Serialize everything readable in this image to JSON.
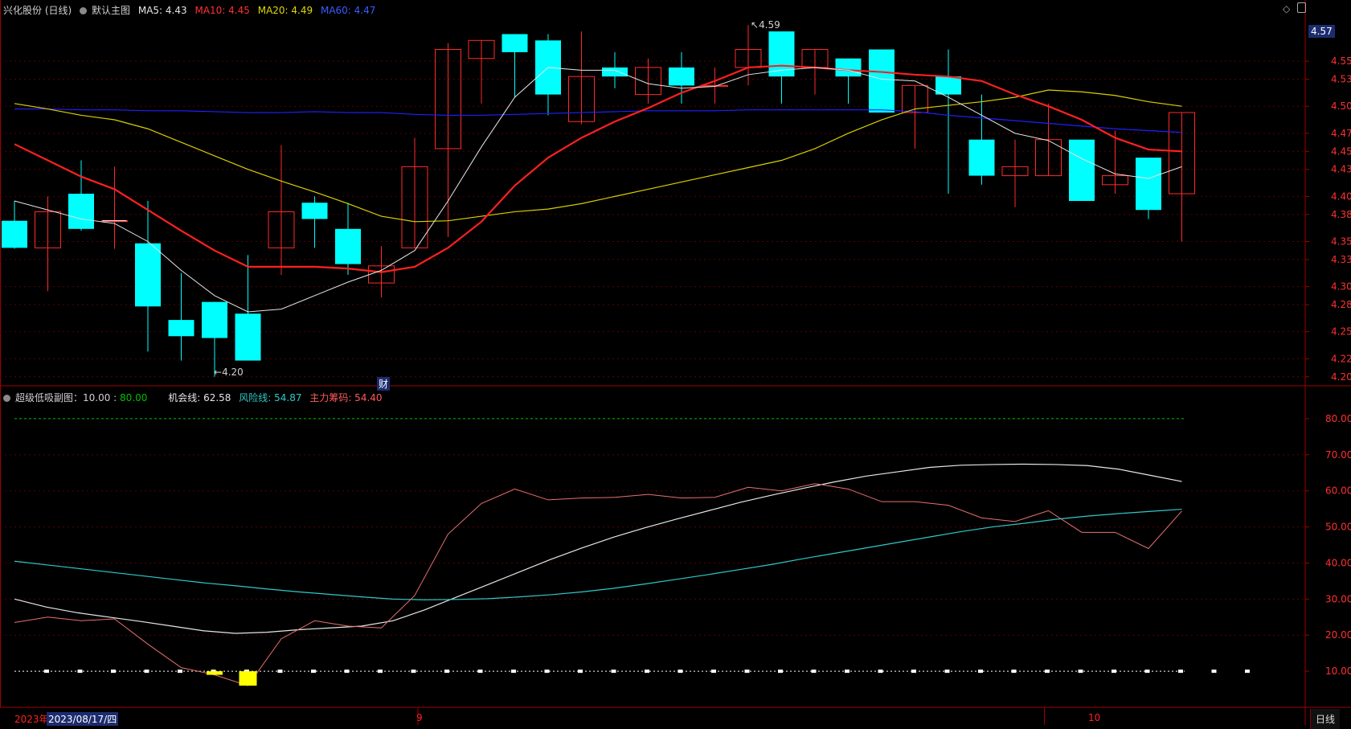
{
  "main_header": {
    "stock": "兴化股份 (日线)",
    "chart_label": "默认主图",
    "ma5": "MA5: 4.43",
    "ma10": "MA10: 4.45",
    "ma20": "MA20: 4.49",
    "ma60": "MA60: 4.47"
  },
  "sub_header": {
    "title": "超级低吸副图：10.00 :",
    "level": "80.00",
    "opportunity": "机会线: 62.58",
    "risk": "风险线: 54.87",
    "main_chip": "主力筹码: 54.40"
  },
  "current_price_tag": "4.57",
  "high_label": "4.59",
  "low_label": "4.20",
  "event_marker": "财",
  "x_axis": {
    "year_label": "2023年",
    "cursor_date": "2023/08/17/四",
    "month_9": "9",
    "month_10": "10"
  },
  "period_tab": "日线",
  "colors": {
    "up": "#ff2a2a",
    "down": "#00ffff",
    "ma5": "#e6e6e6",
    "ma10": "#ff2020",
    "ma20": "#d8d000",
    "ma60": "#2020ff",
    "opportunity": "#e6e6e6",
    "risk": "#30c8c8",
    "chip": "#e87070",
    "level": "#00c000",
    "bottom_bar": "#ffff00"
  },
  "chart_data": [
    {
      "type": "candlestick",
      "name": "main",
      "y_ticks": [
        4.2,
        4.22,
        4.25,
        4.28,
        4.3,
        4.33,
        4.35,
        4.38,
        4.4,
        4.43,
        4.45,
        4.47,
        4.5,
        4.53,
        4.55
      ],
      "ylim": [
        4.19,
        4.6
      ],
      "candles": [
        {
          "o": 4.373,
          "h": 4.395,
          "l": 4.342,
          "c": 4.343
        },
        {
          "o": 4.343,
          "h": 4.4,
          "l": 4.295,
          "c": 4.383
        },
        {
          "o": 4.403,
          "h": 4.44,
          "l": 4.362,
          "c": 4.364
        },
        {
          "o": 4.373,
          "h": 4.433,
          "l": 4.342,
          "c": 4.373
        },
        {
          "o": 4.348,
          "h": 4.395,
          "l": 4.228,
          "c": 4.278
        },
        {
          "o": 4.263,
          "h": 4.315,
          "l": 4.218,
          "c": 4.245
        },
        {
          "o": 4.283,
          "h": 4.283,
          "l": 4.2,
          "c": 4.243
        },
        {
          "o": 4.27,
          "h": 4.335,
          "l": 4.218,
          "c": 4.218
        },
        {
          "o": 4.343,
          "h": 4.457,
          "l": 4.313,
          "c": 4.383
        },
        {
          "o": 4.393,
          "h": 4.4,
          "l": 4.343,
          "c": 4.375
        },
        {
          "o": 4.364,
          "h": 4.393,
          "l": 4.313,
          "c": 4.325
        },
        {
          "o": 4.304,
          "h": 4.345,
          "l": 4.288,
          "c": 4.323
        },
        {
          "o": 4.343,
          "h": 4.465,
          "l": 4.343,
          "c": 4.433
        },
        {
          "o": 4.453,
          "h": 4.57,
          "l": 4.355,
          "c": 4.563
        },
        {
          "o": 4.553,
          "h": 4.573,
          "l": 4.503,
          "c": 4.573
        },
        {
          "o": 4.58,
          "h": 4.58,
          "l": 4.51,
          "c": 4.56
        },
        {
          "o": 4.573,
          "h": 4.58,
          "l": 4.49,
          "c": 4.513
        },
        {
          "o": 4.483,
          "h": 4.583,
          "l": 4.48,
          "c": 4.533
        },
        {
          "o": 4.543,
          "h": 4.56,
          "l": 4.52,
          "c": 4.533
        },
        {
          "o": 4.513,
          "h": 4.553,
          "l": 4.503,
          "c": 4.543
        },
        {
          "o": 4.543,
          "h": 4.56,
          "l": 4.503,
          "c": 4.523
        },
        {
          "o": 4.523,
          "h": 4.543,
          "l": 4.503,
          "c": 4.523
        },
        {
          "o": 4.543,
          "h": 4.59,
          "l": 4.523,
          "c": 4.563
        },
        {
          "o": 4.583,
          "h": 4.583,
          "l": 4.503,
          "c": 4.533
        },
        {
          "o": 4.543,
          "h": 4.563,
          "l": 4.513,
          "c": 4.563
        },
        {
          "o": 4.553,
          "h": 4.553,
          "l": 4.503,
          "c": 4.533
        },
        {
          "o": 4.563,
          "h": 4.563,
          "l": 4.503,
          "c": 4.493
        },
        {
          "o": 4.493,
          "h": 4.523,
          "l": 4.453,
          "c": 4.523
        },
        {
          "o": 4.533,
          "h": 4.563,
          "l": 4.403,
          "c": 4.513
        },
        {
          "o": 4.463,
          "h": 4.513,
          "l": 4.413,
          "c": 4.423
        },
        {
          "o": 4.423,
          "h": 4.463,
          "l": 4.388,
          "c": 4.433
        },
        {
          "o": 4.423,
          "h": 4.503,
          "l": 4.423,
          "c": 4.463
        },
        {
          "o": 4.463,
          "h": 4.463,
          "l": 4.395,
          "c": 4.395
        },
        {
          "o": 4.413,
          "h": 4.473,
          "l": 4.403,
          "c": 4.423
        },
        {
          "o": 4.443,
          "h": 4.443,
          "l": 4.375,
          "c": 4.385
        },
        {
          "o": 4.403,
          "h": 4.493,
          "l": 4.35,
          "c": 4.493
        }
      ],
      "ma5": [
        4.395,
        4.385,
        4.375,
        4.37,
        4.35,
        4.318,
        4.29,
        4.272,
        4.275,
        4.29,
        4.305,
        4.318,
        4.34,
        4.395,
        4.455,
        4.51,
        4.543,
        4.54,
        4.54,
        4.525,
        4.52,
        4.522,
        4.535,
        4.54,
        4.543,
        4.54,
        4.53,
        4.528,
        4.51,
        4.49,
        4.47,
        4.462,
        4.442,
        4.425,
        4.42,
        4.433
      ],
      "ma10": [
        4.458,
        4.44,
        4.422,
        4.408,
        4.385,
        4.362,
        4.34,
        4.322,
        4.322,
        4.322,
        4.32,
        4.316,
        4.322,
        4.343,
        4.372,
        4.412,
        4.443,
        4.465,
        4.483,
        4.498,
        4.515,
        4.528,
        4.543,
        4.545,
        4.543,
        4.54,
        4.538,
        4.535,
        4.533,
        4.528,
        4.513,
        4.5,
        4.485,
        4.465,
        4.452,
        4.45
      ],
      "ma20": [
        4.503,
        4.497,
        4.49,
        4.485,
        4.475,
        4.46,
        4.445,
        4.43,
        4.417,
        4.405,
        4.392,
        4.378,
        4.372,
        4.373,
        4.378,
        4.383,
        4.386,
        4.392,
        4.4,
        4.408,
        4.416,
        4.424,
        4.432,
        4.44,
        4.453,
        4.47,
        4.485,
        4.497,
        4.501,
        4.505,
        4.51,
        4.518,
        4.516,
        4.512,
        4.505,
        4.5
      ],
      "ma60": [
        4.497,
        4.497,
        4.496,
        4.496,
        4.495,
        4.495,
        4.494,
        4.493,
        4.493,
        4.494,
        4.493,
        4.493,
        4.491,
        4.49,
        4.49,
        4.491,
        4.492,
        4.493,
        4.494,
        4.495,
        4.495,
        4.495,
        4.496,
        4.496,
        4.496,
        4.496,
        4.496,
        4.494,
        4.49,
        4.487,
        4.484,
        4.481,
        4.478,
        4.475,
        4.473,
        4.471
      ]
    },
    {
      "type": "line",
      "name": "sub",
      "y_ticks": [
        10,
        20,
        30,
        40,
        50,
        60,
        70,
        80
      ],
      "ylim": [
        0,
        86
      ],
      "series": [
        {
          "name": "机会线",
          "values": [
            30,
            27.8,
            26.2,
            25,
            23.8,
            22.5,
            21.2,
            20.5,
            20.8,
            21.5,
            22,
            22.5,
            24,
            27,
            30.5,
            34,
            37.5,
            41,
            44.2,
            47.2,
            49.8,
            52.2,
            54.5,
            56.8,
            58.8,
            60.7,
            62.5,
            64.1,
            65.3,
            66.5,
            67.1,
            67.3,
            67.4,
            67.3,
            67,
            66,
            64.3,
            62.6
          ]
        },
        {
          "name": "风险线",
          "values": [
            40.5,
            39.5,
            38.5,
            37.5,
            36.5,
            35.5,
            34.5,
            33.7,
            32.8,
            32,
            31.3,
            30.6,
            30,
            29.8,
            29.9,
            30.1,
            30.6,
            31.2,
            32,
            33,
            34.2,
            35.5,
            36.8,
            38.2,
            39.6,
            41.2,
            42.7,
            44.2,
            45.7,
            47.2,
            48.7,
            50,
            51,
            52.1,
            53,
            53.7,
            54.3,
            54.9
          ]
        },
        {
          "name": "主力筹码",
          "values": [
            23.5,
            25,
            24,
            24.5,
            17.5,
            11,
            9,
            6,
            19,
            24,
            22.5,
            22,
            31,
            48,
            56.5,
            60.5,
            57.5,
            58,
            58.2,
            59,
            58,
            58.2,
            61,
            60,
            62,
            60.5,
            57,
            57,
            56,
            52.5,
            51.5,
            54.5,
            48.5,
            48.5,
            44,
            54.4
          ]
        }
      ],
      "bottom_bars": [
        {
          "index": 6,
          "value": 9
        },
        {
          "index": 7,
          "value": 6
        }
      ]
    }
  ]
}
